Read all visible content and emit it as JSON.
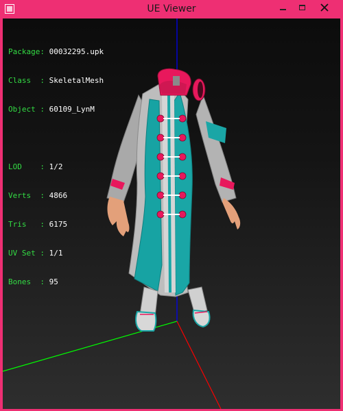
{
  "window": {
    "title": "UE Viewer",
    "buttons": {
      "minimize": "minimize-icon",
      "maximize": "maximize-icon",
      "close": "close-icon"
    }
  },
  "info": {
    "mesh": [
      {
        "key": "Package:",
        "value": "00032295.upk"
      },
      {
        "key": "Class  :",
        "value": "SkeletalMesh"
      },
      {
        "key": "Object :",
        "value": "60109_LynM"
      }
    ],
    "stats": [
      {
        "key": "LOD    :",
        "value": "1/2"
      },
      {
        "key": "Verts  :",
        "value": "4866"
      },
      {
        "key": "Tris   :",
        "value": "6175"
      },
      {
        "key": "UV Set :",
        "value": "1/1"
      },
      {
        "key": "Bones  :",
        "value": "95"
      }
    ]
  },
  "colors": {
    "frame": "#ee2f73",
    "info_key": "#33dd44",
    "info_value": "#ffffff",
    "axis_x": "#ff0000",
    "axis_y": "#00ff00",
    "axis_z": "#0000ff",
    "coat_teal": "#1aa6a6",
    "coat_grey": "#b9b9b9",
    "accent_pink": "#e8185c"
  }
}
